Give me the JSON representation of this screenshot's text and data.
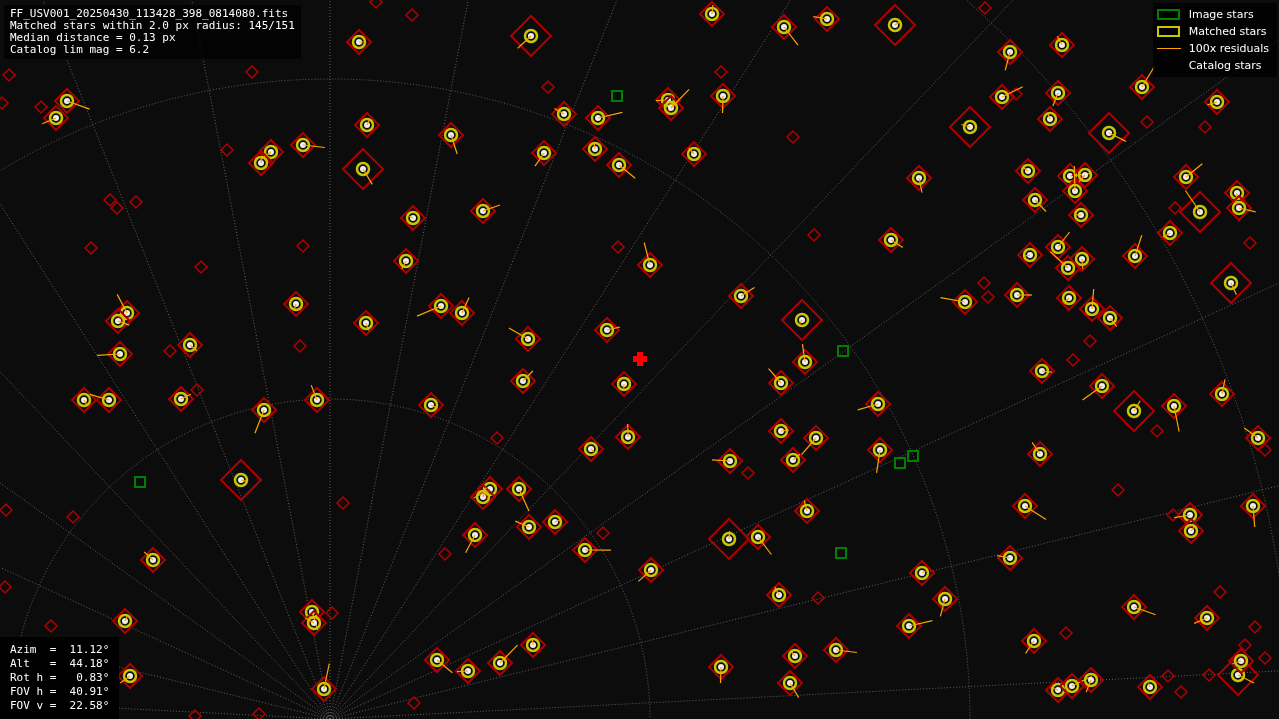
{
  "file_info": [
    "FF_USV001_20250430_113428_398_0814080.fits",
    "Matched stars within 2.0 px radius: 145/151",
    "Median distance = 0.13 px",
    "Catalog lim mag = 6.2"
  ],
  "legend": [
    {
      "label": "Image stars",
      "kind": "box",
      "color": "#008000"
    },
    {
      "label": "Matched stars",
      "kind": "box",
      "color": "#c8c800"
    },
    {
      "label": "100x residuals",
      "kind": "line",
      "color": "#ffa500"
    },
    {
      "label": "Catalog stars",
      "kind": "none"
    }
  ],
  "pointing": [
    "Azim  =  11.12°",
    "Alt   =  44.18°",
    "Rot h =   0.83°",
    "FOV h =  40.91°",
    "FOV v =  22.58°"
  ]
}
